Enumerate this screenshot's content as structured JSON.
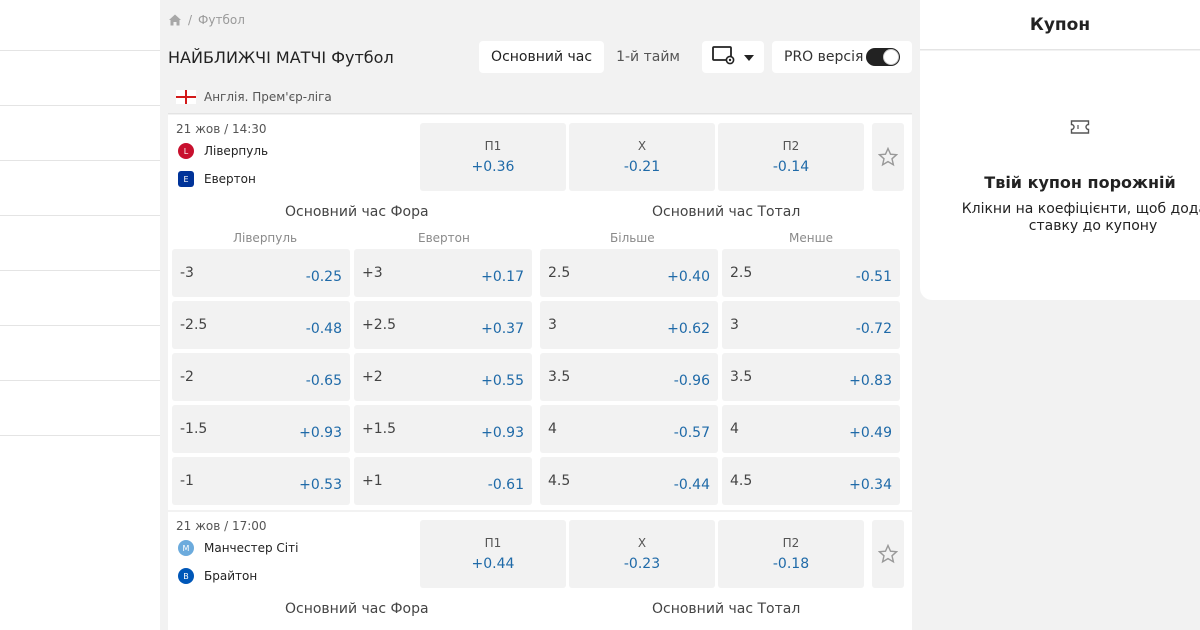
{
  "breadcrumb": {
    "current": "Футбол",
    "separator": "/"
  },
  "header": {
    "title": "НАЙБЛИЖЧІ МАТЧІ Футбол",
    "tabs": [
      "Основний час",
      "1-й тайм"
    ],
    "pro_label": "PRO версія"
  },
  "league": {
    "name": "Англія. Прем'єр-ліга"
  },
  "matches": [
    {
      "datetime": "21 жов / 14:30",
      "home": "Ліверпуль",
      "away": "Евертон",
      "home_color": "#c8102e",
      "away_color": "#003399",
      "odds": [
        {
          "label": "П1",
          "value": "+0.36"
        },
        {
          "label": "X",
          "value": "-0.21"
        },
        {
          "label": "П2",
          "value": "-0.14"
        }
      ],
      "handicap_title": "Основний час Фора",
      "total_title": "Основний час Тотал",
      "columns": [
        "Ліверпуль",
        "Евертон",
        "Більше",
        "Менше"
      ],
      "handicap_home": [
        {
          "line": "-3",
          "value": "-0.25"
        },
        {
          "line": "-2.5",
          "value": "-0.48"
        },
        {
          "line": "-2",
          "value": "-0.65"
        },
        {
          "line": "-1.5",
          "value": "+0.93"
        },
        {
          "line": "-1",
          "value": "+0.53"
        }
      ],
      "handicap_away": [
        {
          "line": "+3",
          "value": "+0.17"
        },
        {
          "line": "+2.5",
          "value": "+0.37"
        },
        {
          "line": "+2",
          "value": "+0.55"
        },
        {
          "line": "+1.5",
          "value": "+0.93"
        },
        {
          "line": "+1",
          "value": "-0.61"
        }
      ],
      "total_over": [
        {
          "line": "2.5",
          "value": "+0.40"
        },
        {
          "line": "3",
          "value": "+0.62"
        },
        {
          "line": "3.5",
          "value": "-0.96"
        },
        {
          "line": "4",
          "value": "-0.57"
        },
        {
          "line": "4.5",
          "value": "-0.44"
        }
      ],
      "total_under": [
        {
          "line": "2.5",
          "value": "-0.51"
        },
        {
          "line": "3",
          "value": "-0.72"
        },
        {
          "line": "3.5",
          "value": "+0.83"
        },
        {
          "line": "4",
          "value": "+0.49"
        },
        {
          "line": "4.5",
          "value": "+0.34"
        }
      ]
    },
    {
      "datetime": "21 жов / 17:00",
      "home": "Манчестер Сіті",
      "away": "Брайтон",
      "home_color": "#6cabdd",
      "away_color": "#0057b8",
      "odds": [
        {
          "label": "П1",
          "value": "+0.44"
        },
        {
          "label": "X",
          "value": "-0.23"
        },
        {
          "label": "П2",
          "value": "-0.18"
        }
      ],
      "handicap_title": "Основний час Фора",
      "total_title": "Основний час Тотал"
    }
  ],
  "coupon": {
    "title": "Купон",
    "empty_title": "Твій купон порожній",
    "empty_text": "Клікни на коефіцієнти, щоб додати ставку до купону"
  },
  "colors": {
    "odds_value": "#1f6aa8",
    "panel_bg": "#f2f2f2"
  }
}
